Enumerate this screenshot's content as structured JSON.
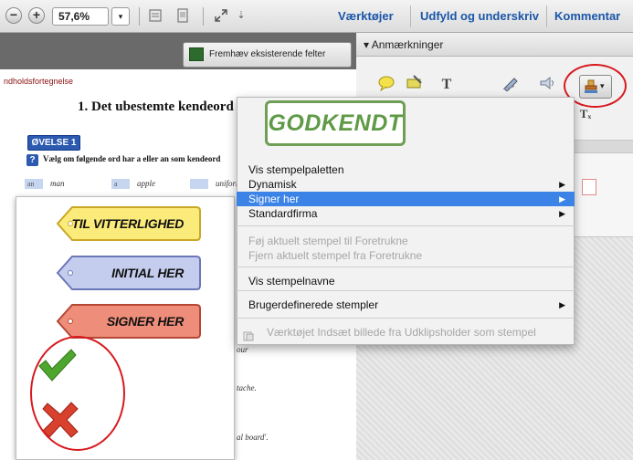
{
  "toolbar": {
    "zoom_out_symbol": "−",
    "zoom_in_symbol": "+",
    "zoom_value": "57,6%",
    "zoom_dropdown_symbol": "▾",
    "more_symbol": "⇣",
    "tabs": [
      "Værktøjer",
      "Udfyld og underskriv",
      "Kommentar"
    ]
  },
  "document": {
    "highlight_button": "Fremhæv eksisterende felter",
    "toc_label": "ndholdsfortegnelse",
    "chapter_title": "1. Det ubestemte kendeord",
    "exercise_badge": "ØVELSE 1",
    "question_mark": "?",
    "question_text": "Vælg om følgende ord har a eller an som kendeord",
    "word_items": [
      {
        "box": "an",
        "word": "man"
      },
      {
        "box": "a",
        "word": "apple"
      },
      {
        "box": "",
        "word": "uniform"
      }
    ],
    "fragments": [
      "our",
      "tache.",
      "al board'."
    ]
  },
  "stamp_palette": {
    "stamps": [
      {
        "label": "TIL VITTERLIGHED",
        "fill": "#fbeb7a",
        "stroke": "#c9a728"
      },
      {
        "label": "INITIAL HER",
        "fill": "#c4cdee",
        "stroke": "#6b78b8"
      },
      {
        "label": "SIGNER HER",
        "fill": "#ee8e7a",
        "stroke": "#b54735"
      }
    ],
    "check_color": "#4fa62e",
    "x_color": "#d8412e"
  },
  "annotations_panel": {
    "title": "▾ Anmærkninger",
    "tools": [
      "speech-bubble-icon",
      "highlighter-icon",
      "text-icon",
      "pencil-icon",
      "attach-icon",
      "stamp-icon"
    ],
    "text_tool_glyph": "T",
    "text_sub_glyph": "Tₓ"
  },
  "menu": {
    "stamp_preview": "GODKENDT",
    "items": [
      {
        "label": "Vis stempelpaletten",
        "enabled": true,
        "arrow": false,
        "selected": false
      },
      {
        "label": "Dynamisk",
        "enabled": true,
        "arrow": true,
        "selected": false
      },
      {
        "label": "Signer her",
        "enabled": true,
        "arrow": true,
        "selected": true
      },
      {
        "label": "Standardfirma",
        "enabled": true,
        "arrow": true,
        "selected": false
      },
      {
        "label": "Føj aktuelt stempel til Foretrukne",
        "enabled": false,
        "arrow": false,
        "selected": false
      },
      {
        "label": "Fjern aktuelt stempel fra Foretrukne",
        "enabled": false,
        "arrow": false,
        "selected": false
      },
      {
        "label": "Vis stempelnavne",
        "enabled": true,
        "arrow": false,
        "selected": false
      },
      {
        "label": "Brugerdefinerede stempler",
        "enabled": true,
        "arrow": true,
        "selected": false
      },
      {
        "label": "Værktøjet Indsæt billede fra Udklipsholder som stempel",
        "enabled": false,
        "arrow": false,
        "selected": false
      }
    ]
  },
  "colors": {
    "accent": "#3b83e6",
    "annotation_circle": "#d8191e",
    "link_blue": "#1a56a8"
  }
}
